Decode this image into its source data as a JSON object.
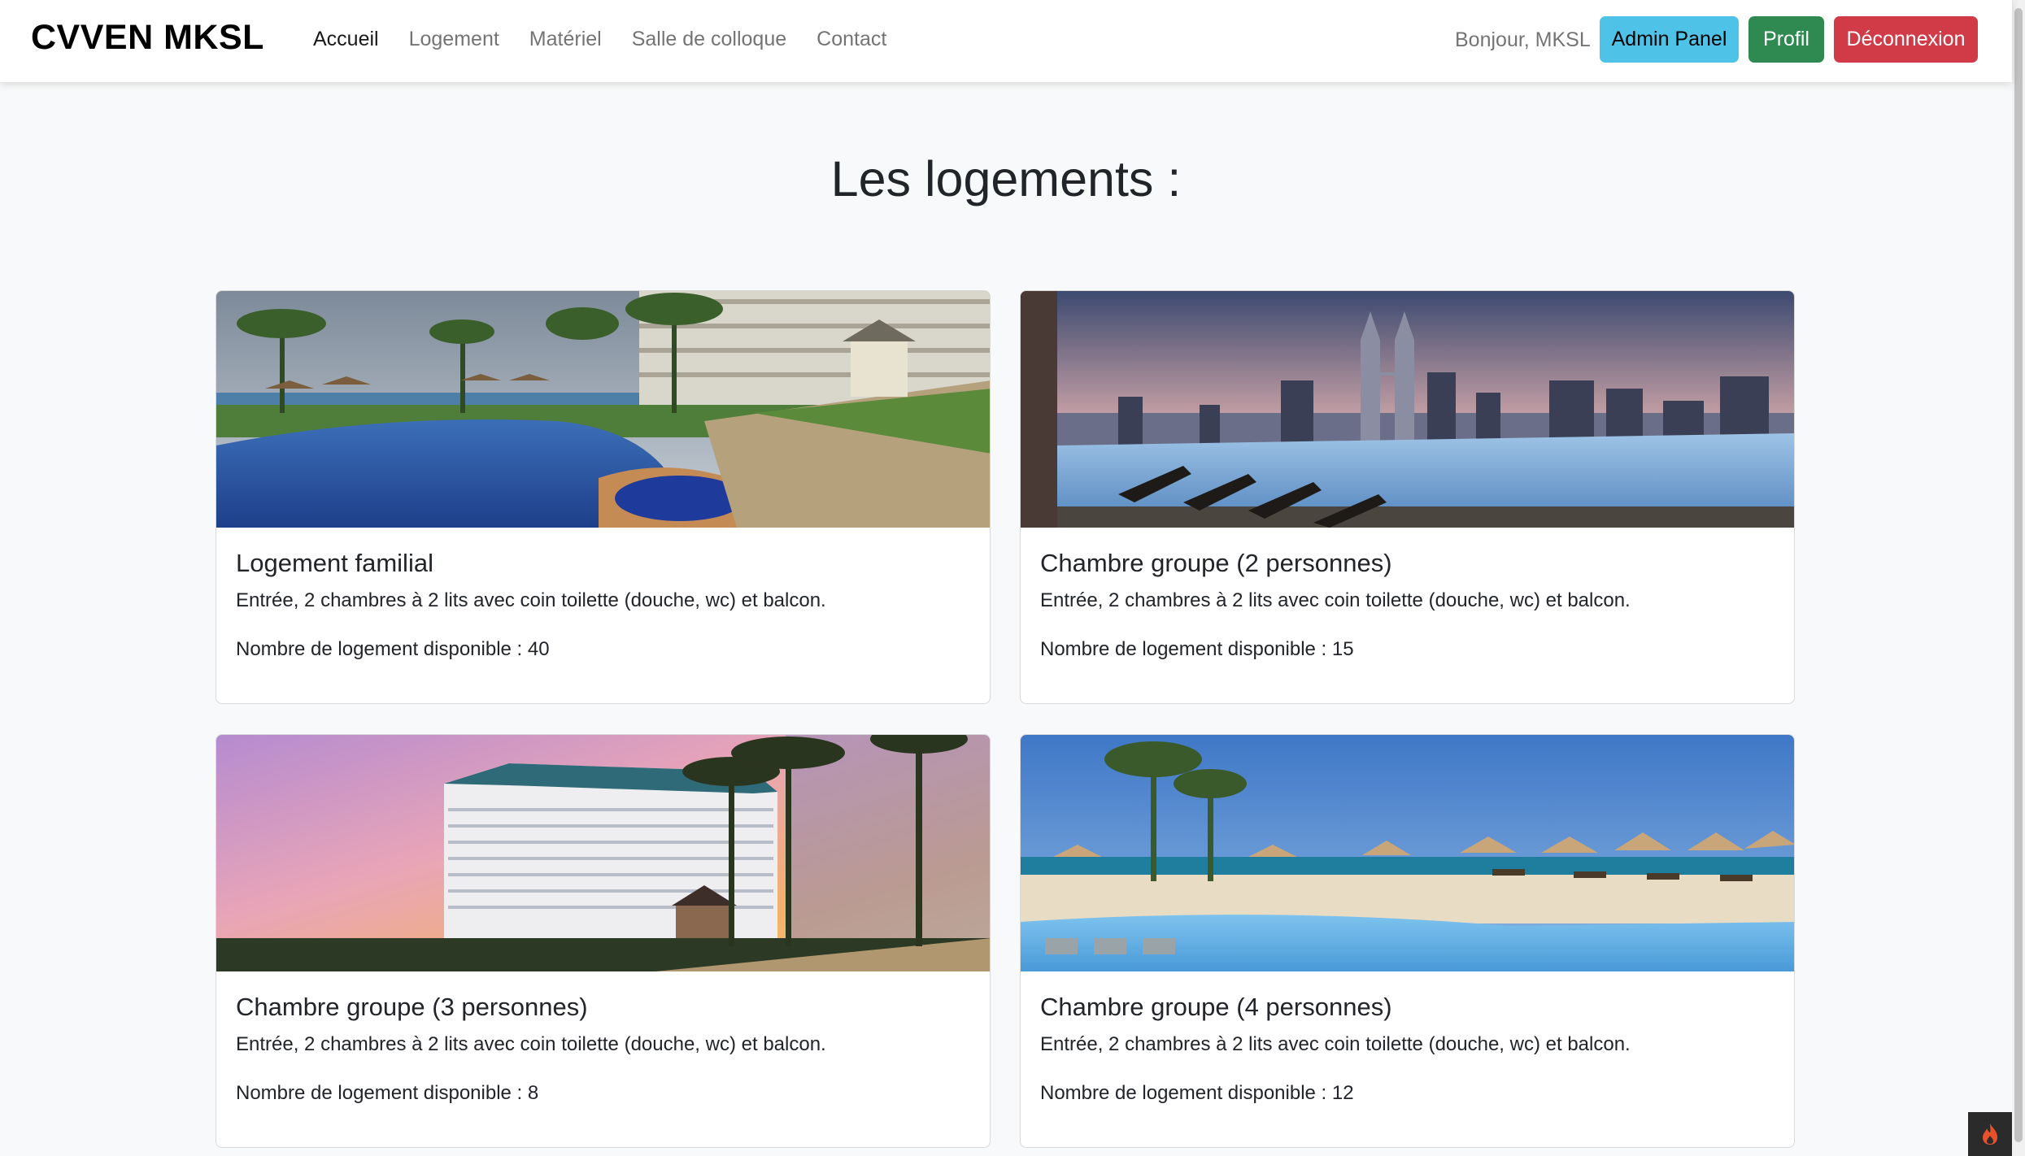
{
  "navbar": {
    "brand": "CVVEN MKSL",
    "links": [
      {
        "label": "Accueil",
        "active": true
      },
      {
        "label": "Logement",
        "active": false
      },
      {
        "label": "Matériel",
        "active": false
      },
      {
        "label": "Salle de colloque",
        "active": false
      },
      {
        "label": "Contact",
        "active": false
      }
    ],
    "greeting": "Bonjour, MKSL",
    "admin_label": "Admin Panel",
    "profile_label": "Profil",
    "logout_label": "Déconnexion"
  },
  "main": {
    "title": "Les logements :",
    "cards": [
      {
        "title": "Logement familial",
        "description": "Entrée, 2 chambres à 2 lits avec coin toilette (douche, wc) et balcon.",
        "count_text": "Nombre de logement disponible : 40",
        "image": "resort-pool-photo"
      },
      {
        "title": "Chambre groupe (2 personnes)",
        "description": "Entrée, 2 chambres à 2 lits avec coin toilette (douche, wc) et balcon.",
        "count_text": "Nombre de logement disponible : 15",
        "image": "rooftop-infinity-pool-photo"
      },
      {
        "title": "Chambre groupe (3 personnes)",
        "description": "Entrée, 2 chambres à 2 lits avec coin toilette (douche, wc) et balcon.",
        "count_text": "Nombre de logement disponible : 8",
        "image": "hotel-tower-sunset-photo"
      },
      {
        "title": "Chambre groupe (4 personnes)",
        "description": "Entrée, 2 chambres à 2 lits avec coin toilette (douche, wc) et balcon.",
        "count_text": "Nombre de logement disponible : 12",
        "image": "beach-pool-umbrellas-photo"
      }
    ]
  },
  "colors": {
    "info": "#4fc3e7",
    "success": "#2f8a52",
    "danger": "#d13b48",
    "background": "#f8f9fa"
  },
  "floating_button_icon": "flame-icon"
}
